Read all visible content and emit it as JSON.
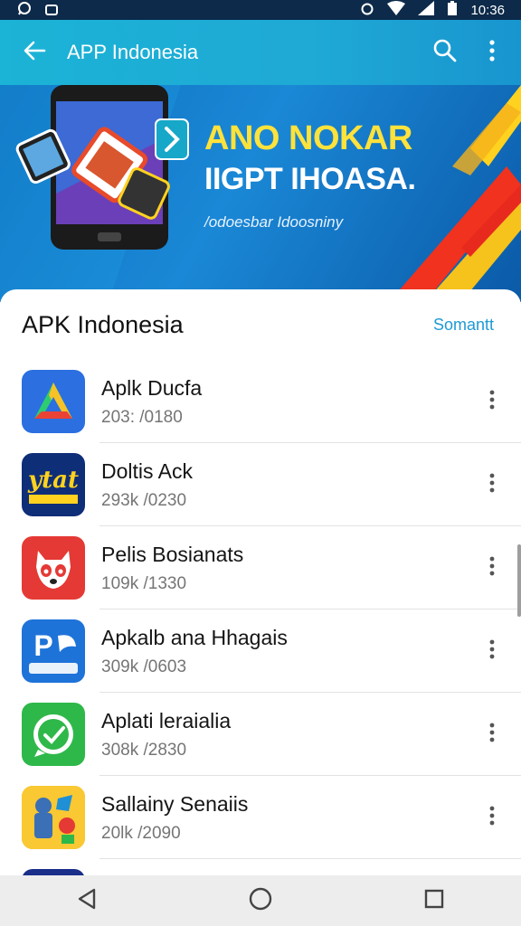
{
  "status_bar": {
    "time": "10:36",
    "icons": [
      "whatsapp-icon",
      "image-icon",
      "alarm-icon",
      "wifi-icon",
      "signal-icon",
      "battery-icon"
    ]
  },
  "app_bar": {
    "title": "APP Indonesia",
    "icons": [
      "back-arrow-icon",
      "search-icon",
      "more-vertical-icon"
    ],
    "color": "#1bb3d6"
  },
  "banner": {
    "headline": "ANO NOKAR",
    "subheadline": "IIGPT IHOASA.",
    "tagline": "/odoesbar Idoosniny"
  },
  "section": {
    "title": "APK Indonesia",
    "action": "Somantt"
  },
  "apps": [
    {
      "name": "Aplk Ducfa",
      "meta": "203: /0180",
      "icon": "triangle-logo-icon"
    },
    {
      "name": "Doltis Ack",
      "meta": "293k /0230",
      "icon": "dark-blue-logo-icon",
      "icon_text": "ytat"
    },
    {
      "name": "Pelis Bosianats",
      "meta": "109k /1330",
      "icon": "panda-icon"
    },
    {
      "name": "Apkalb ana Hhagais",
      "meta": "309k /0603",
      "icon": "blue-p-logo-icon",
      "icon_text": "P"
    },
    {
      "name": "Aplati leraialia",
      "meta": "308k /2830",
      "icon": "green-chat-icon"
    },
    {
      "name": "Sallainy Senaiis",
      "meta": "20Ɩk /2090",
      "icon": "game-character-icon"
    },
    {
      "name": "",
      "meta": "",
      "icon": "play-logo-icon"
    }
  ],
  "nav_bar": {
    "icons": [
      "back-triangle-icon",
      "home-circle-icon",
      "recents-square-icon"
    ]
  },
  "colors": {
    "accent": "#1e9ad6",
    "banner_yellow": "#ffe23b",
    "banner_blue": "#1a88d6"
  }
}
